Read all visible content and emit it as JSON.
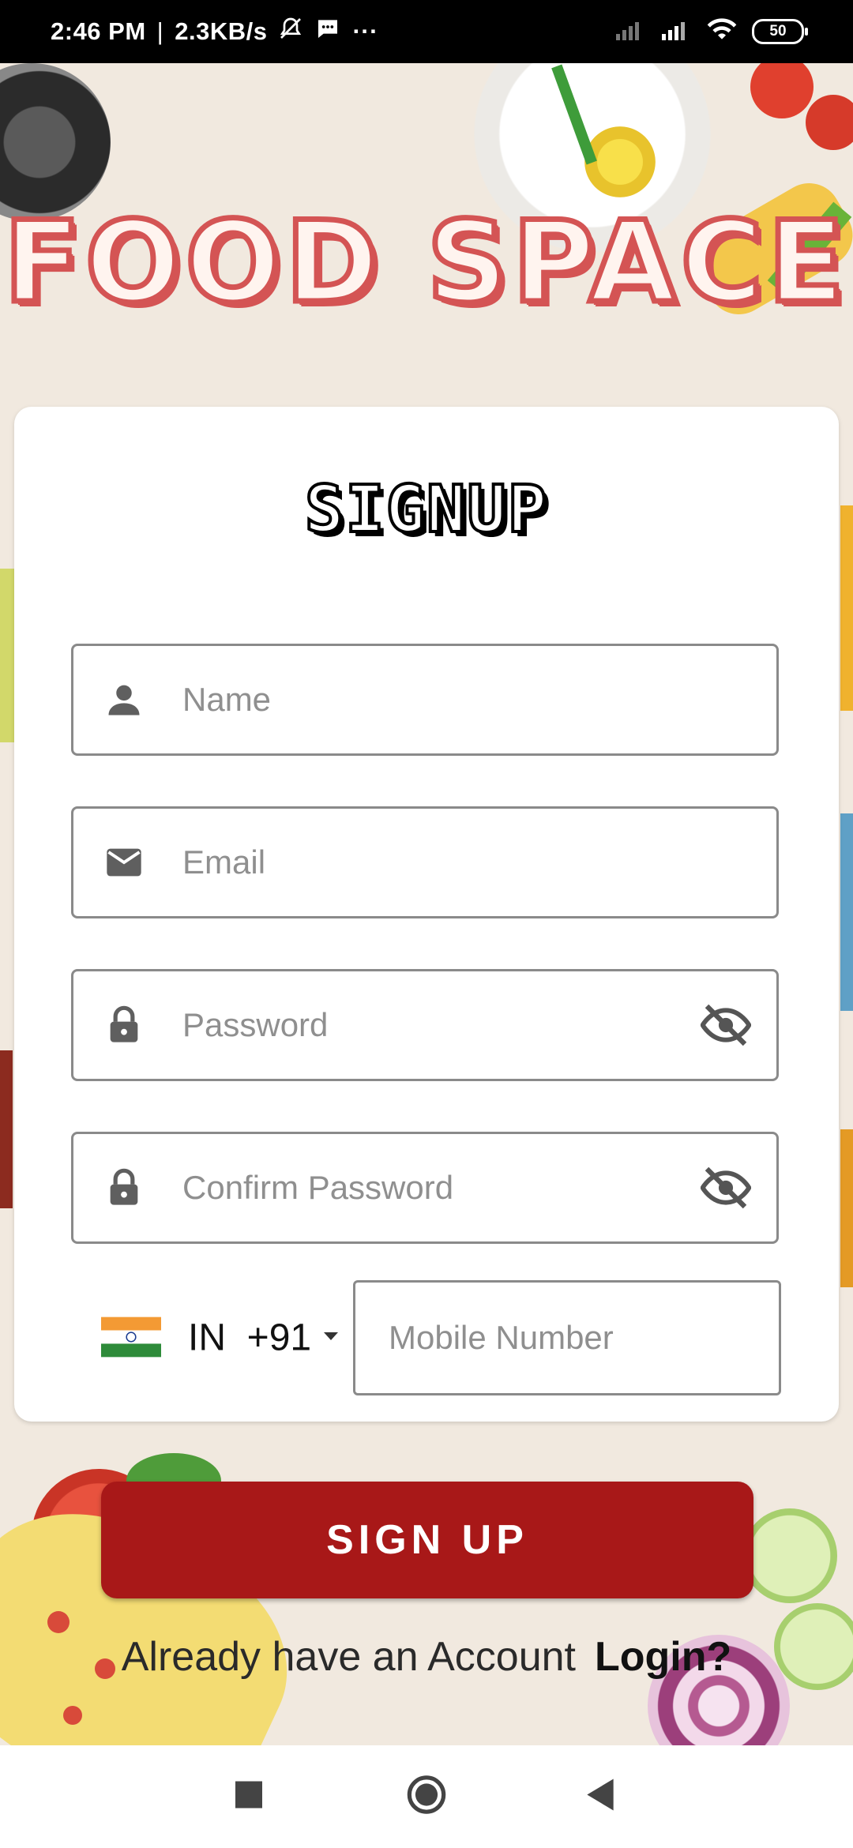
{
  "status_bar": {
    "time": "2:46 PM",
    "network_speed": "2.3KB/s",
    "more": "···",
    "battery": "50",
    "icons": [
      "bell-mute-icon",
      "message-icon",
      "signal-icon",
      "signal-icon",
      "wifi-icon",
      "battery-icon"
    ]
  },
  "app": {
    "title": "FOOD SPACE"
  },
  "form": {
    "title": "SIGNUP",
    "name_placeholder": "Name",
    "email_placeholder": "Email",
    "password_placeholder": "Password",
    "confirm_password_placeholder": "Confirm Password",
    "country": "IN",
    "dial_code": "+91",
    "mobile_placeholder": "Mobile Number"
  },
  "actions": {
    "signup_label": "SIGN UP",
    "login_prompt": "Already have an Account",
    "login_link": "Login?"
  },
  "colors": {
    "brand_red": "#a81818",
    "title_red": "#d45454",
    "background": "#f1e9df"
  }
}
